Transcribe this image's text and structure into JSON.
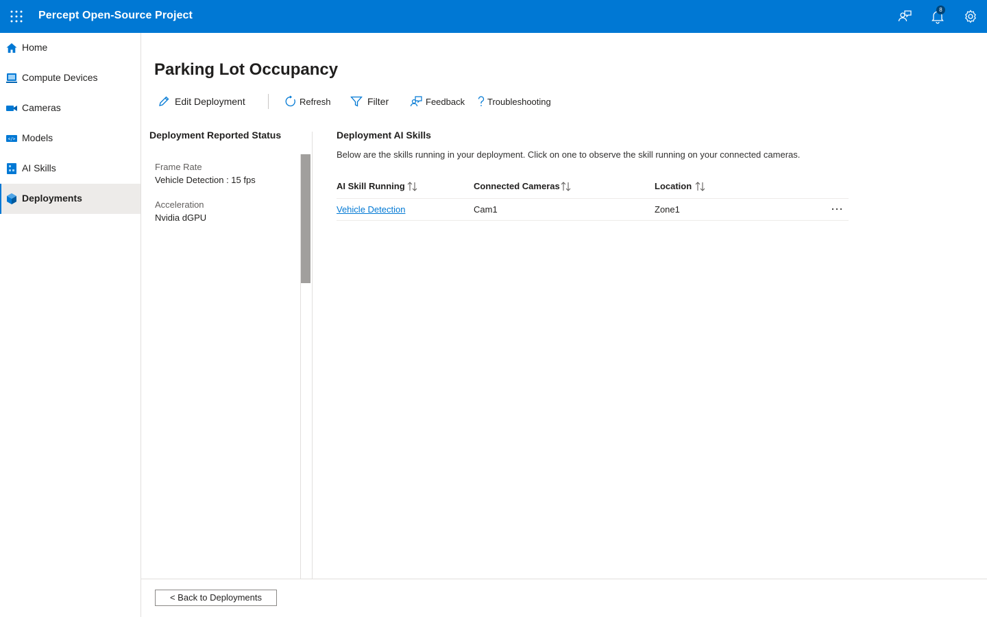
{
  "header": {
    "app_title": "Percept Open-Source Project",
    "notification_count": "8",
    "icons": [
      "waffle-icon",
      "feedback-people-icon",
      "bell-icon",
      "gear-icon"
    ],
    "accent_color": "#0078d4"
  },
  "sidebar": {
    "items": [
      {
        "label": "Home",
        "icon": "home-icon"
      },
      {
        "label": "Compute Devices",
        "icon": "compute-device-icon"
      },
      {
        "label": "Cameras",
        "icon": "camera-icon"
      },
      {
        "label": "Models",
        "icon": "model-icon"
      },
      {
        "label": "AI Skills",
        "icon": "ai-skill-icon"
      },
      {
        "label": "Deployments",
        "icon": "deployment-icon",
        "active": true
      }
    ]
  },
  "page": {
    "title": "Parking Lot Occupancy"
  },
  "commands": {
    "edit": "Edit Deployment",
    "refresh": "Refresh",
    "filter": "Filter",
    "feedback": "Feedback",
    "troubleshooting": "Troubleshooting"
  },
  "status_panel": {
    "title": "Deployment Reported Status",
    "fields": [
      {
        "label": "Frame Rate",
        "value": "Vehicle Detection : 15 fps"
      },
      {
        "label": "Acceleration",
        "value": "Nvidia dGPU"
      }
    ]
  },
  "skills_panel": {
    "title": "Deployment AI Skills",
    "description": "Below are the skills running in your deployment. Click on one to observe the skill running on your connected cameras.",
    "columns": [
      "AI Skill Running",
      "Connected Cameras",
      "Location"
    ],
    "rows": [
      {
        "skill": "Vehicle Detection",
        "cameras": "Cam1",
        "location": "Zone1"
      }
    ]
  },
  "footer": {
    "back_label": "< Back to Deployments"
  }
}
